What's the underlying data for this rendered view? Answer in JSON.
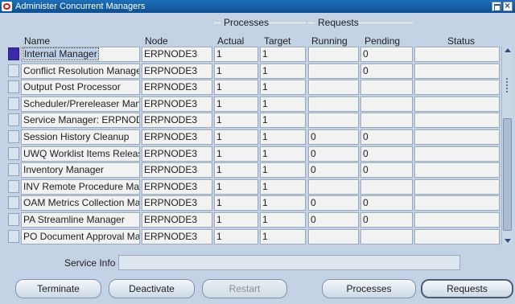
{
  "window": {
    "title": "Administer Concurrent Managers"
  },
  "groups": {
    "processes": "Processes",
    "requests": "Requests"
  },
  "columns": {
    "name": "Name",
    "node": "Node",
    "actual": "Actual",
    "target": "Target",
    "running": "Running",
    "pending": "Pending",
    "status": "Status"
  },
  "rows": [
    {
      "name": "Internal Manager",
      "node": "ERPNODE3",
      "actual": "1",
      "target": "1",
      "running": "",
      "pending": "0",
      "status": ""
    },
    {
      "name": "Conflict Resolution Manager",
      "node": "ERPNODE3",
      "actual": "1",
      "target": "1",
      "running": "",
      "pending": "0",
      "status": ""
    },
    {
      "name": "Output Post Processor",
      "node": "ERPNODE3",
      "actual": "1",
      "target": "1",
      "running": "",
      "pending": "",
      "status": ""
    },
    {
      "name": "Scheduler/Prereleaser Manag",
      "node": "ERPNODE3",
      "actual": "1",
      "target": "1",
      "running": "",
      "pending": "",
      "status": ""
    },
    {
      "name": "Service Manager: ERPNODE",
      "node": "ERPNODE3",
      "actual": "1",
      "target": "1",
      "running": "",
      "pending": "",
      "status": ""
    },
    {
      "name": "Session History Cleanup",
      "node": "ERPNODE3",
      "actual": "1",
      "target": "1",
      "running": "0",
      "pending": "0",
      "status": ""
    },
    {
      "name": "UWQ Worklist Items Release",
      "node": "ERPNODE3",
      "actual": "1",
      "target": "1",
      "running": "0",
      "pending": "0",
      "status": ""
    },
    {
      "name": "Inventory Manager",
      "node": "ERPNODE3",
      "actual": "1",
      "target": "1",
      "running": "0",
      "pending": "0",
      "status": ""
    },
    {
      "name": "INV Remote Procedure Mana",
      "node": "ERPNODE3",
      "actual": "1",
      "target": "1",
      "running": "",
      "pending": "",
      "status": ""
    },
    {
      "name": "OAM Metrics Collection Man",
      "node": "ERPNODE3",
      "actual": "1",
      "target": "1",
      "running": "0",
      "pending": "0",
      "status": ""
    },
    {
      "name": "PA Streamline Manager",
      "node": "ERPNODE3",
      "actual": "1",
      "target": "1",
      "running": "0",
      "pending": "0",
      "status": ""
    },
    {
      "name": "PO Document Approval Mana",
      "node": "ERPNODE3",
      "actual": "1",
      "target": "1",
      "running": "",
      "pending": "",
      "status": ""
    }
  ],
  "service_info": {
    "label": "Service Info",
    "value": ""
  },
  "buttons": {
    "terminate": "Terminate",
    "deactivate": "Deactivate",
    "restart": "Restart",
    "processes": "Processes",
    "requests": "Requests"
  },
  "colors": {
    "background": "#c3d3e5",
    "titlebar": "#1d6fb9",
    "current_record_indicator": "#3c2aa8"
  }
}
